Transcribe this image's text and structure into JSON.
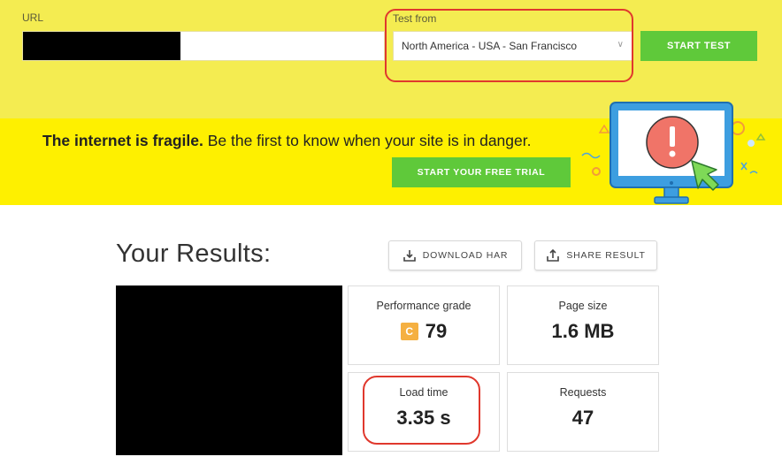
{
  "test_form": {
    "url_label": "URL",
    "url_value": "",
    "test_from_label": "Test from",
    "location_selected": "North America - USA - San Francisco",
    "start_label": "START TEST"
  },
  "banner": {
    "bold_text": "The internet is fragile.",
    "rest_text": " Be the first to know when your site is in danger.",
    "cta_label": "START YOUR FREE TRIAL"
  },
  "results": {
    "title": "Your Results:",
    "download_label": "DOWNLOAD HAR",
    "share_label": "SHARE RESULT",
    "performance": {
      "label": "Performance grade",
      "grade_letter": "C",
      "score": "79"
    },
    "page_size": {
      "label": "Page size",
      "value": "1.6 MB"
    },
    "load_time": {
      "label": "Load time",
      "value": "3.35 s"
    },
    "requests": {
      "label": "Requests",
      "value": "47"
    }
  },
  "colors": {
    "topbar_yellow": "#f4ec51",
    "banner_yellow": "#fef000",
    "button_green": "#5fc93a",
    "grade_orange": "#f5b041",
    "annotation_red": "#e0382d"
  },
  "icons": [
    "chevron-down-icon",
    "monitor-alert-icon",
    "cursor-arrow-icon",
    "download-icon",
    "share-icon"
  ]
}
